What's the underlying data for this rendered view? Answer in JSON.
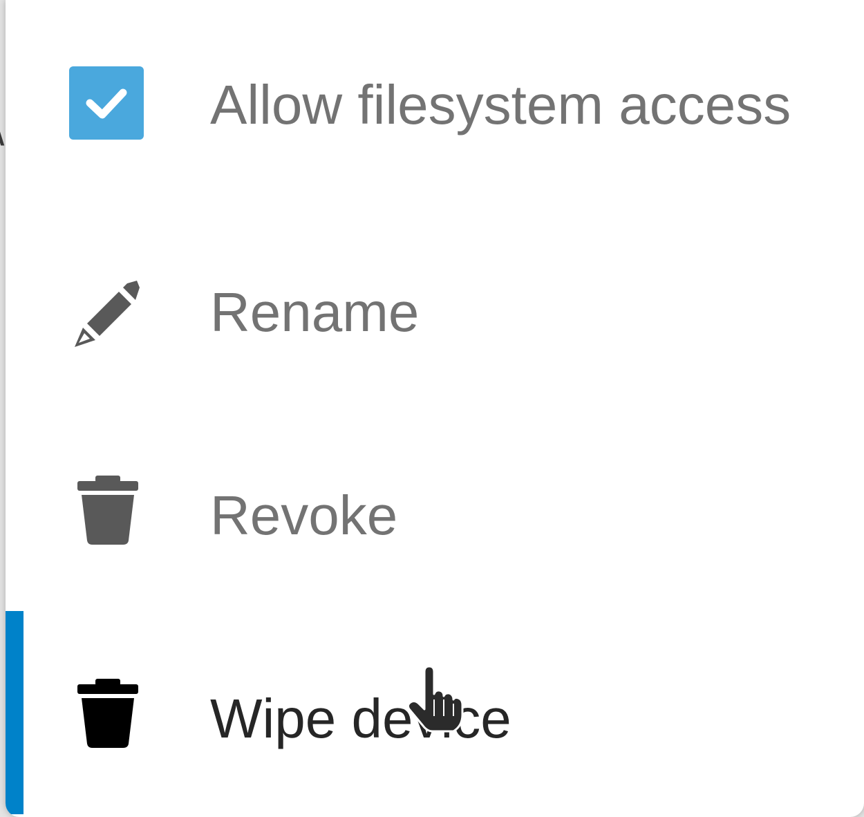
{
  "menu": {
    "items": [
      {
        "label": "Allow filesystem access",
        "icon": "checkbox-checked-icon",
        "checked": true
      },
      {
        "label": "Rename",
        "icon": "pencil-icon"
      },
      {
        "label": "Revoke",
        "icon": "trash-icon"
      },
      {
        "label": "Wipe device",
        "icon": "trash-icon",
        "active": true
      }
    ]
  },
  "colors": {
    "checkbox": "#4aa8dd",
    "active_indicator": "#0082c9",
    "text": "#737373",
    "text_active": "#262626"
  }
}
